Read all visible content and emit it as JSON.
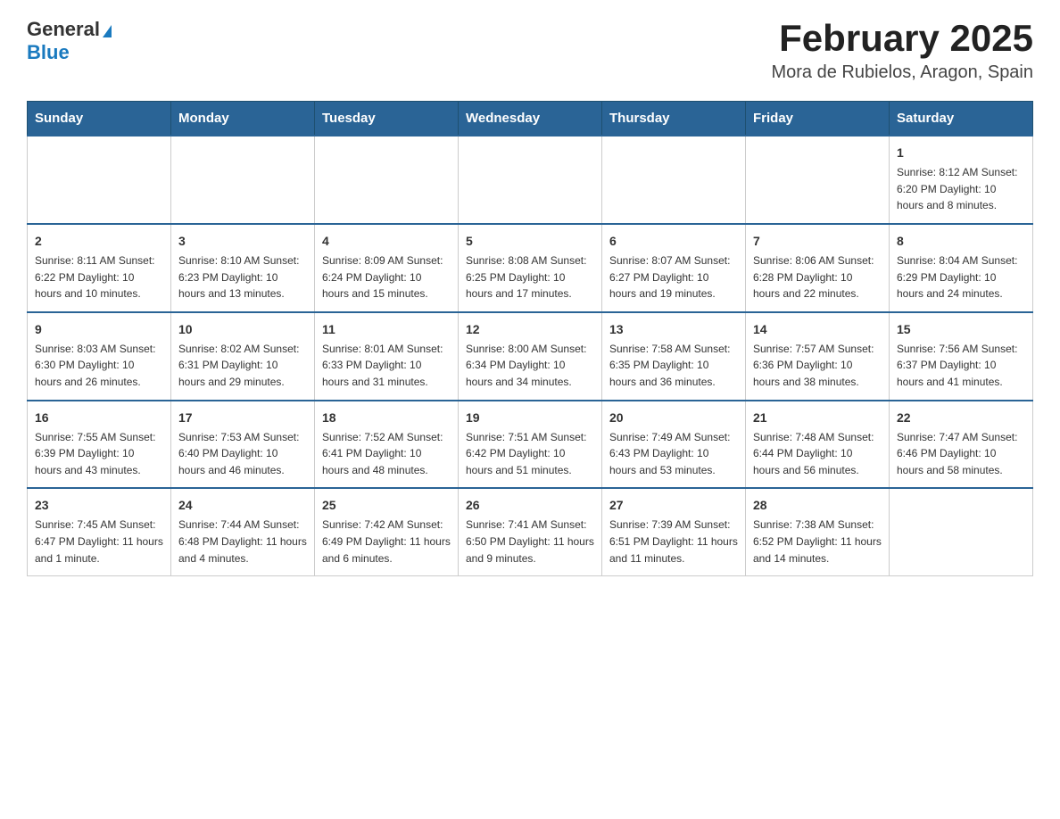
{
  "header": {
    "logo": {
      "line1": "General",
      "triangle": "▶",
      "line2": "Blue"
    },
    "title": "February 2025",
    "subtitle": "Mora de Rubielos, Aragon, Spain"
  },
  "calendar": {
    "weekdays": [
      "Sunday",
      "Monday",
      "Tuesday",
      "Wednesday",
      "Thursday",
      "Friday",
      "Saturday"
    ],
    "weeks": [
      [
        {
          "day": "",
          "info": ""
        },
        {
          "day": "",
          "info": ""
        },
        {
          "day": "",
          "info": ""
        },
        {
          "day": "",
          "info": ""
        },
        {
          "day": "",
          "info": ""
        },
        {
          "day": "",
          "info": ""
        },
        {
          "day": "1",
          "info": "Sunrise: 8:12 AM\nSunset: 6:20 PM\nDaylight: 10 hours and 8 minutes."
        }
      ],
      [
        {
          "day": "2",
          "info": "Sunrise: 8:11 AM\nSunset: 6:22 PM\nDaylight: 10 hours and 10 minutes."
        },
        {
          "day": "3",
          "info": "Sunrise: 8:10 AM\nSunset: 6:23 PM\nDaylight: 10 hours and 13 minutes."
        },
        {
          "day": "4",
          "info": "Sunrise: 8:09 AM\nSunset: 6:24 PM\nDaylight: 10 hours and 15 minutes."
        },
        {
          "day": "5",
          "info": "Sunrise: 8:08 AM\nSunset: 6:25 PM\nDaylight: 10 hours and 17 minutes."
        },
        {
          "day": "6",
          "info": "Sunrise: 8:07 AM\nSunset: 6:27 PM\nDaylight: 10 hours and 19 minutes."
        },
        {
          "day": "7",
          "info": "Sunrise: 8:06 AM\nSunset: 6:28 PM\nDaylight: 10 hours and 22 minutes."
        },
        {
          "day": "8",
          "info": "Sunrise: 8:04 AM\nSunset: 6:29 PM\nDaylight: 10 hours and 24 minutes."
        }
      ],
      [
        {
          "day": "9",
          "info": "Sunrise: 8:03 AM\nSunset: 6:30 PM\nDaylight: 10 hours and 26 minutes."
        },
        {
          "day": "10",
          "info": "Sunrise: 8:02 AM\nSunset: 6:31 PM\nDaylight: 10 hours and 29 minutes."
        },
        {
          "day": "11",
          "info": "Sunrise: 8:01 AM\nSunset: 6:33 PM\nDaylight: 10 hours and 31 minutes."
        },
        {
          "day": "12",
          "info": "Sunrise: 8:00 AM\nSunset: 6:34 PM\nDaylight: 10 hours and 34 minutes."
        },
        {
          "day": "13",
          "info": "Sunrise: 7:58 AM\nSunset: 6:35 PM\nDaylight: 10 hours and 36 minutes."
        },
        {
          "day": "14",
          "info": "Sunrise: 7:57 AM\nSunset: 6:36 PM\nDaylight: 10 hours and 38 minutes."
        },
        {
          "day": "15",
          "info": "Sunrise: 7:56 AM\nSunset: 6:37 PM\nDaylight: 10 hours and 41 minutes."
        }
      ],
      [
        {
          "day": "16",
          "info": "Sunrise: 7:55 AM\nSunset: 6:39 PM\nDaylight: 10 hours and 43 minutes."
        },
        {
          "day": "17",
          "info": "Sunrise: 7:53 AM\nSunset: 6:40 PM\nDaylight: 10 hours and 46 minutes."
        },
        {
          "day": "18",
          "info": "Sunrise: 7:52 AM\nSunset: 6:41 PM\nDaylight: 10 hours and 48 minutes."
        },
        {
          "day": "19",
          "info": "Sunrise: 7:51 AM\nSunset: 6:42 PM\nDaylight: 10 hours and 51 minutes."
        },
        {
          "day": "20",
          "info": "Sunrise: 7:49 AM\nSunset: 6:43 PM\nDaylight: 10 hours and 53 minutes."
        },
        {
          "day": "21",
          "info": "Sunrise: 7:48 AM\nSunset: 6:44 PM\nDaylight: 10 hours and 56 minutes."
        },
        {
          "day": "22",
          "info": "Sunrise: 7:47 AM\nSunset: 6:46 PM\nDaylight: 10 hours and 58 minutes."
        }
      ],
      [
        {
          "day": "23",
          "info": "Sunrise: 7:45 AM\nSunset: 6:47 PM\nDaylight: 11 hours and 1 minute."
        },
        {
          "day": "24",
          "info": "Sunrise: 7:44 AM\nSunset: 6:48 PM\nDaylight: 11 hours and 4 minutes."
        },
        {
          "day": "25",
          "info": "Sunrise: 7:42 AM\nSunset: 6:49 PM\nDaylight: 11 hours and 6 minutes."
        },
        {
          "day": "26",
          "info": "Sunrise: 7:41 AM\nSunset: 6:50 PM\nDaylight: 11 hours and 9 minutes."
        },
        {
          "day": "27",
          "info": "Sunrise: 7:39 AM\nSunset: 6:51 PM\nDaylight: 11 hours and 11 minutes."
        },
        {
          "day": "28",
          "info": "Sunrise: 7:38 AM\nSunset: 6:52 PM\nDaylight: 11 hours and 14 minutes."
        },
        {
          "day": "",
          "info": ""
        }
      ]
    ]
  }
}
